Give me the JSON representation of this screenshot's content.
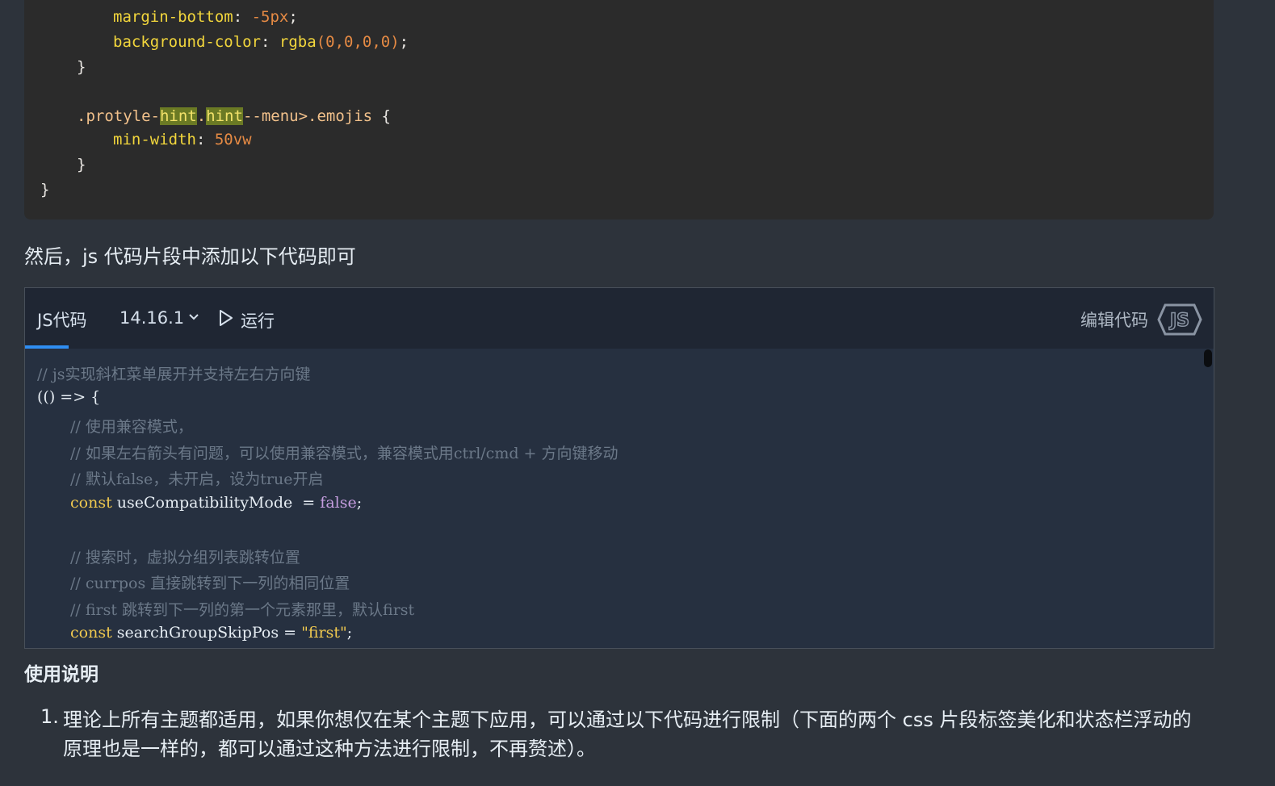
{
  "css_code": {
    "line1_prop": "margin-bottom",
    "line1_val": "-5px",
    "line2_prop": "background-color",
    "line2_fn": "rgba",
    "line2_args": "(0,0,0,0)",
    "brace_close": "}",
    "sel_prefix": ".protyle-",
    "sel_hint1": "hint",
    "sel_dot": ".",
    "sel_hint2": "hint",
    "sel_suffix": "--menu>.emojis",
    "sel_brace": " {",
    "min_width_prop": "min-width",
    "min_width_val": "50vw"
  },
  "paragraph": "然后，js 代码片段中添加以下代码即可",
  "js_block": {
    "tab_label": "JS代码",
    "version": "14.16.1",
    "run_label": "运行",
    "edit_label": "编辑代码",
    "lines": {
      "c1": "// js实现斜杠菜单展开并支持左右方向键",
      "l2": "(() => {",
      "c3": "// 使用兼容模式，",
      "c4": "// 如果左右箭头有问题，可以使用兼容模式，兼容模式用ctrl/cmd + 方向键移动",
      "c5": "// 默认false，未开启，设为true开启",
      "kw6": "const",
      "var6": " useCompatibilityMode  = ",
      "bool6": "false",
      "end6": ";",
      "c8": "// 搜索时，虚拟分组列表跳转位置",
      "c9": "// currpos 直接跳转到下一列的相同位置",
      "c10": "// first 跳转到下一列的第一个元素那里，默认first",
      "kw11": "const",
      "var11": " searchGroupSkipPos = ",
      "str11": "\"first\"",
      "end11": ";"
    }
  },
  "usage": {
    "title": "使用说明",
    "item1_num": "1.",
    "item1_text": "理论上所有主题都适用，如果你想仅在某个主题下应用，可以通过以下代码进行限制（下面的两个 css 片段标签美化和状态栏浮动的原理也是一样的，都可以通过这种方法进行限制，不再赘述）。"
  }
}
